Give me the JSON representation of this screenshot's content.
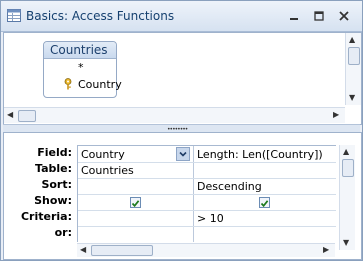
{
  "window": {
    "title": "Basics: Access Functions",
    "controls": {
      "minimize": "minimize-icon",
      "maximize": "maximize-icon",
      "close": "close-icon"
    }
  },
  "table_pane": {
    "table": {
      "name": "Countries",
      "fields": [
        {
          "label": "*",
          "key": false
        },
        {
          "label": "Country",
          "key": true
        }
      ]
    }
  },
  "grid": {
    "row_labels": [
      "Field:",
      "Table:",
      "Sort:",
      "Show:",
      "Criteria:",
      "or:"
    ],
    "columns": [
      {
        "field": "Country",
        "table": "Countries",
        "sort": "",
        "show": true,
        "criteria": "",
        "or": ""
      },
      {
        "field": "Length: Len([Country])",
        "table": "",
        "sort": "Descending",
        "show": true,
        "criteria": "> 10",
        "or": ""
      }
    ]
  },
  "colors": {
    "title_text": "#15406f",
    "checkmark": "#1d7a1d",
    "pane_border": "#9fb2cc"
  }
}
